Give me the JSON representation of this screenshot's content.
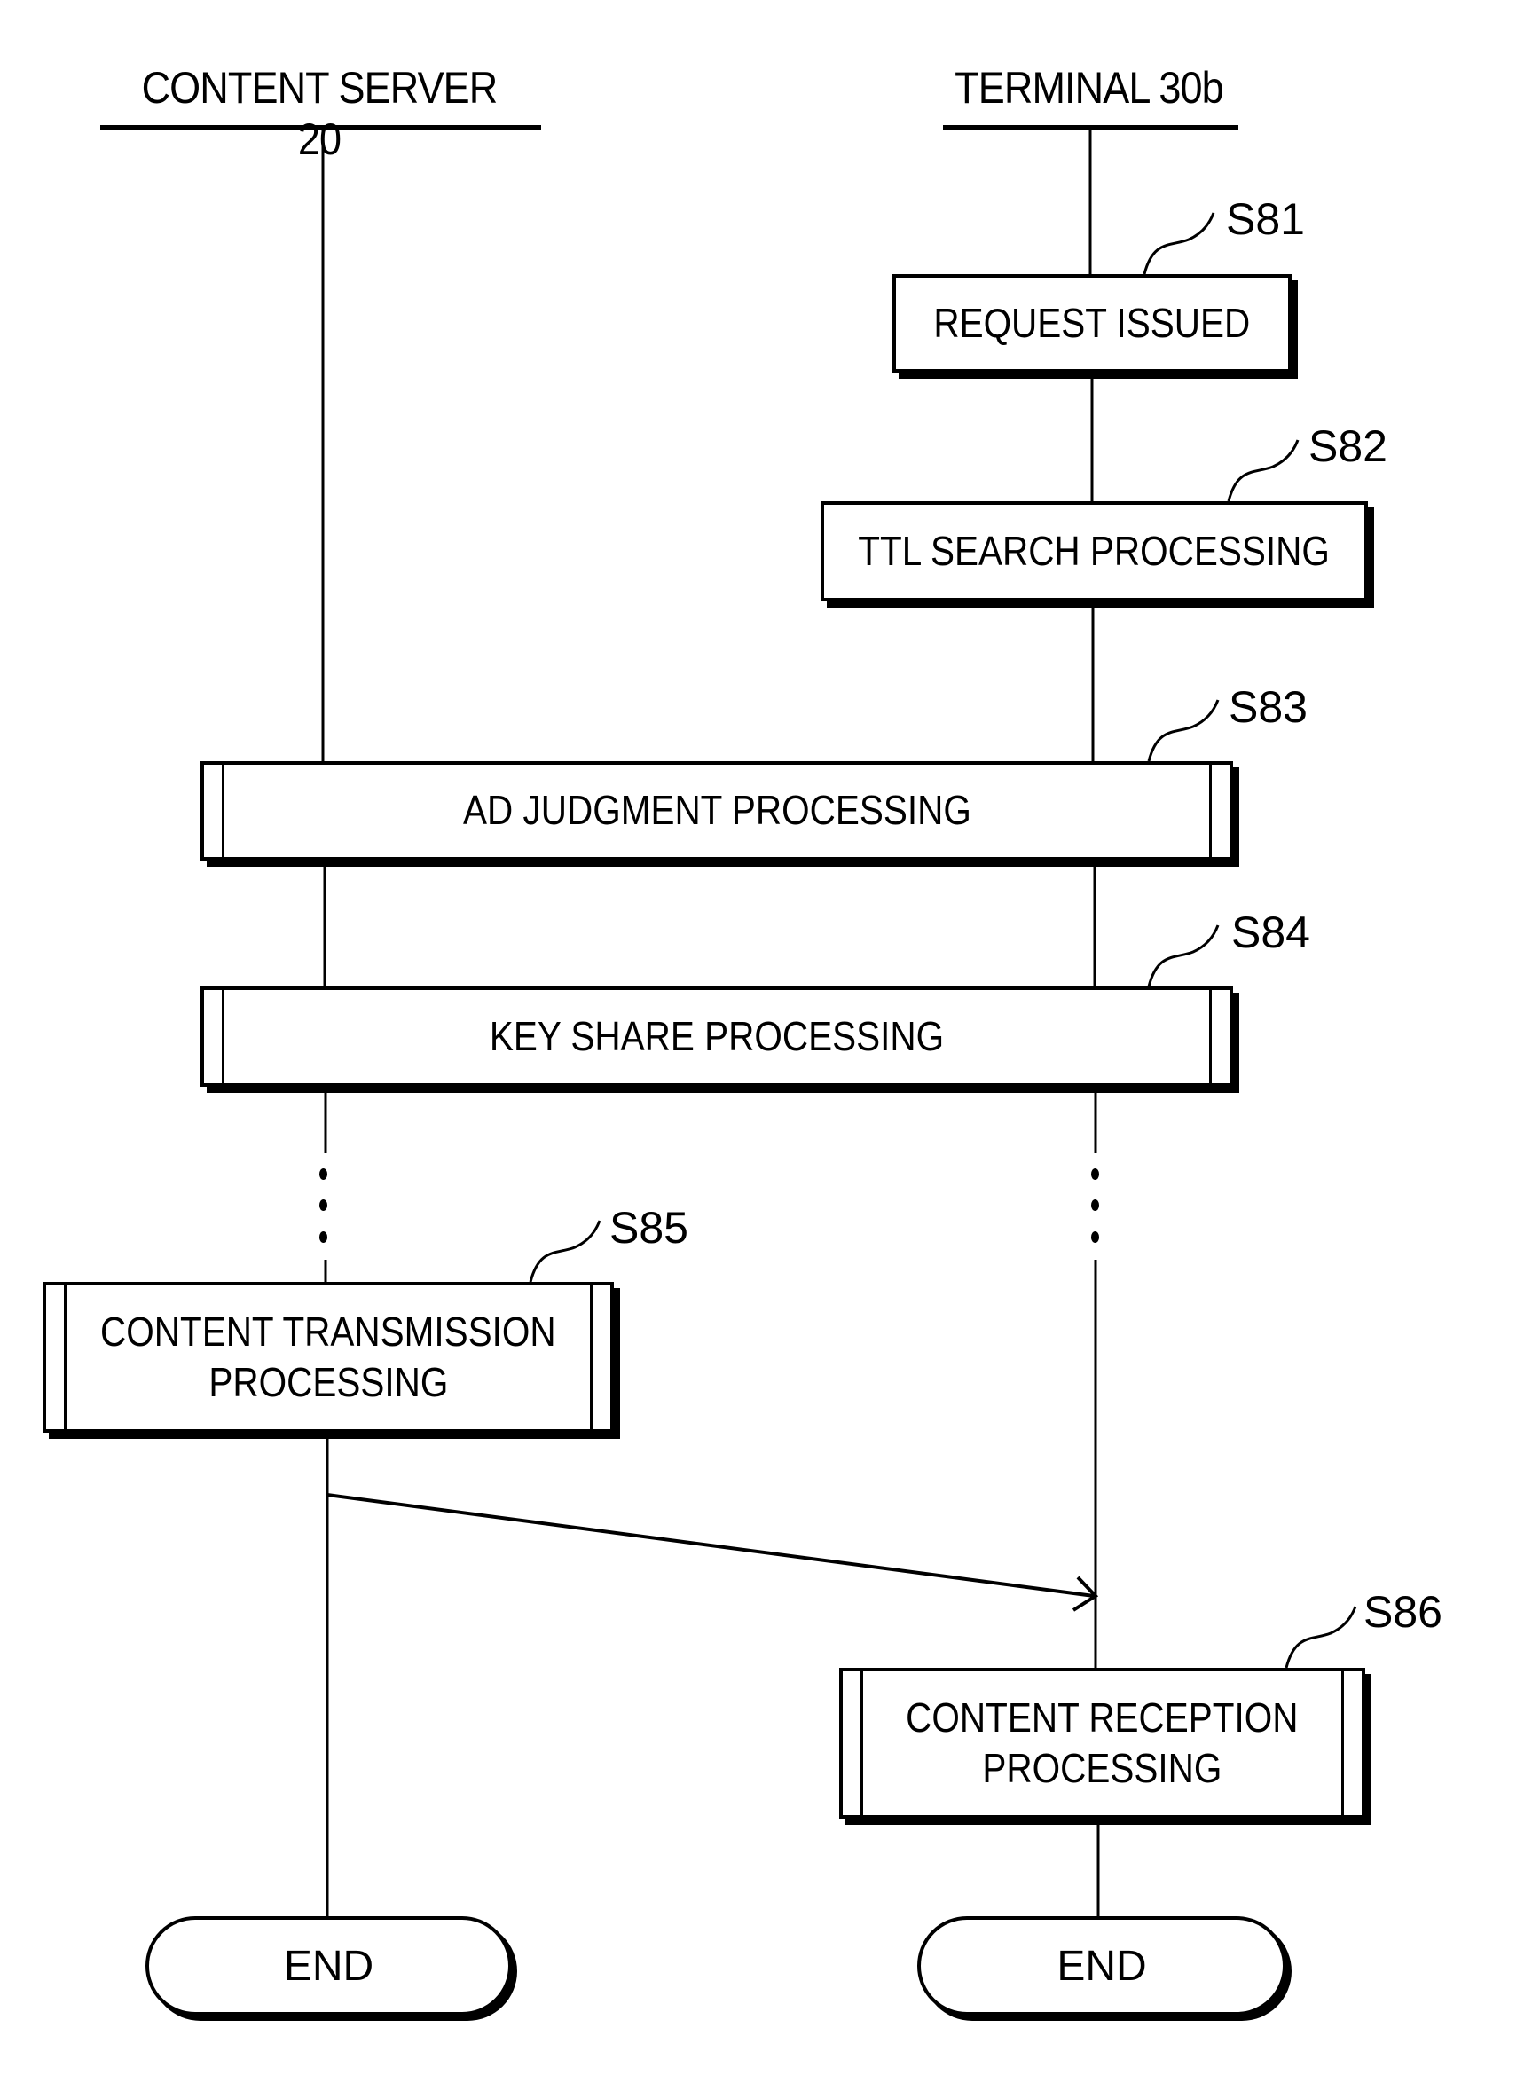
{
  "lanes": {
    "server": {
      "label": "CONTENT SERVER 20"
    },
    "terminal": {
      "label": "TERMINAL 30b"
    }
  },
  "steps": [
    {
      "id": "S81",
      "text": "REQUEST ISSUED",
      "lane": "terminal",
      "type": "process"
    },
    {
      "id": "S82",
      "text": "TTL SEARCH PROCESSING",
      "lane": "terminal",
      "type": "process"
    },
    {
      "id": "S83",
      "text": "AD JUDGMENT PROCESSING",
      "lane": "both",
      "type": "subroutine"
    },
    {
      "id": "S84",
      "text": "KEY SHARE PROCESSING",
      "lane": "both",
      "type": "subroutine"
    },
    {
      "id": "S85",
      "text": "CONTENT TRANSMISSION PROCESSING",
      "lane": "server",
      "type": "subroutine"
    },
    {
      "id": "S86",
      "text": "CONTENT RECEPTION PROCESSING",
      "lane": "terminal",
      "type": "subroutine"
    }
  ],
  "step_text_lines": {
    "S85": [
      "CONTENT TRANSMISSION",
      "PROCESSING"
    ],
    "S86": [
      "CONTENT RECEPTION",
      "PROCESSING"
    ]
  },
  "terminators": {
    "server_end": "END",
    "terminal_end": "END"
  },
  "messages": [
    {
      "from": "server",
      "to": "terminal",
      "after": "S85",
      "before": "S86"
    }
  ]
}
